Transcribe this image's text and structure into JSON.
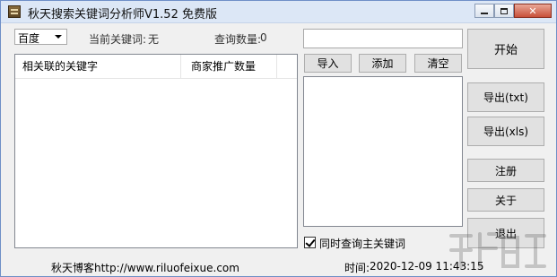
{
  "window": {
    "title": "秋天搜索关键词分析师V1.52 免费版",
    "controls": {
      "minimize": "minimize",
      "maximize": "maximize",
      "close": "x"
    }
  },
  "search_engine": {
    "selected": "百度"
  },
  "status": {
    "keyword_caption": "当前关键词:",
    "keyword_value": "无",
    "count_caption": "查询数量:",
    "count_value": "0"
  },
  "results_table": {
    "columns": [
      "相关联的关键字",
      "商家推广数量"
    ],
    "rows": []
  },
  "keyword_input": {
    "value": ""
  },
  "keyword_buttons": {
    "import": "导入",
    "add": "添加",
    "clear": "清空"
  },
  "keyword_list": {
    "value": ""
  },
  "actions": {
    "start": "开始",
    "export_txt": "导出(txt)",
    "export_xls": "导出(xls)",
    "register": "注册",
    "about": "关于",
    "exit": "退出"
  },
  "options": {
    "also_query_main_keyword": {
      "label": "同时查询主关键词",
      "checked": true
    }
  },
  "footer": {
    "blog": "秋天博客http://www.riluofeixue.com",
    "time_caption": "时间:",
    "time_value": "2020-12-09 11:43:15"
  },
  "colors": {
    "titlebar": "#dce7f6",
    "window_bg": "#f0f0f0",
    "button_bg": "#e1e1e1",
    "close_button": "#c8503a"
  },
  "icons": [
    "app-icon",
    "minimize-icon",
    "maximize-icon",
    "close-icon",
    "checkbox-checked-icon",
    "dropdown-arrow-icon"
  ]
}
